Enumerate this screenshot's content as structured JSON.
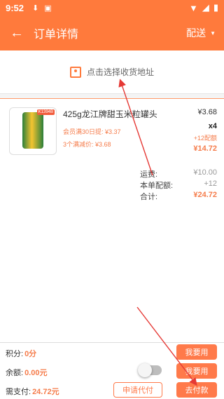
{
  "status_bar": {
    "time": "9:52",
    "download_icon": "download-icon",
    "a_icon": "a-badge-icon"
  },
  "app_bar": {
    "title": "订单详情",
    "delivery": "配送"
  },
  "address": {
    "prompt": "点击选择收货地址"
  },
  "product": {
    "name": "425g龙江牌甜玉米粒罐头",
    "badge": "K1394B",
    "promo_member": "会员满30日提: ¥3.37",
    "promo_discount": "3个满减价: ¥3.68",
    "price": "¥3.68",
    "quantity": "x4",
    "extra": "+12配额",
    "subtotal": "¥14.72"
  },
  "summary": {
    "shipping_label": "运费:",
    "shipping_value": "¥10.00",
    "quota_label": "本单配额:",
    "quota_value": "+12",
    "total_label": "合计:",
    "total_value": "¥24.72"
  },
  "bottom": {
    "points_label": "积分:",
    "points_value": "0分",
    "points_button": "我要用",
    "balance_label": "余额:",
    "balance_value": "0.00元",
    "balance_button": "我要用",
    "pay_label": "需支付:",
    "pay_value": "24.72元",
    "proxy_button": "申请代付",
    "pay_button": "去付款"
  },
  "colors": {
    "accent": "#ff7a3c",
    "price": "#f57c4b"
  }
}
